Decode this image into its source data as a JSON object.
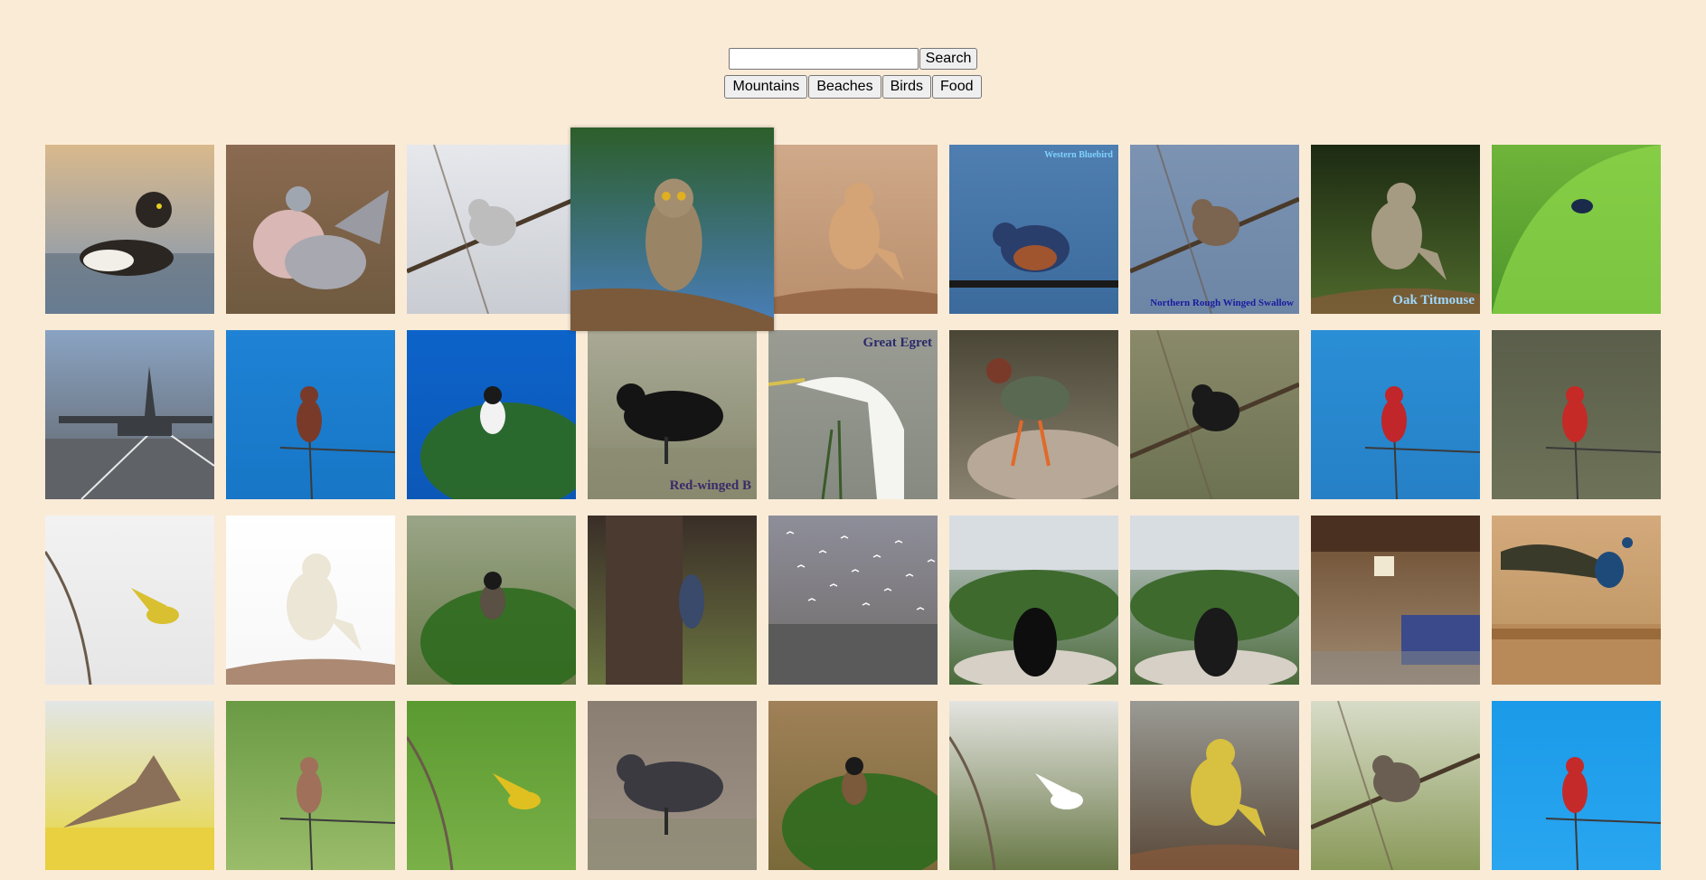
{
  "search": {
    "value": "",
    "placeholder": "",
    "button_label": "Search"
  },
  "categories": [
    {
      "label": "Mountains"
    },
    {
      "label": "Beaches"
    },
    {
      "label": "Birds"
    },
    {
      "label": "Food"
    }
  ],
  "colors": {
    "page_background": "#faebd7"
  },
  "photos": [
    {
      "name": "photo-tufted-duck",
      "bg1": "#d9b98c",
      "bg2": "#7a94b4",
      "subject": "#2b2622",
      "shape": "duck"
    },
    {
      "name": "photo-wood-pigeons",
      "bg1": "#8a6a50",
      "bg2": "#6f5a40",
      "subject": "#c9b4b6",
      "shape": "pigeon"
    },
    {
      "name": "photo-shrike-branches",
      "bg1": "#e6e8ec",
      "bg2": "#c9ccd2",
      "subject": "#bdbdbd",
      "shape": "branchbird"
    },
    {
      "name": "photo-great-horned-owl",
      "bg1": "#2d5e2a",
      "bg2": "#4a7fbf",
      "subject": "#9a8466",
      "shape": "owl",
      "zoomed": true
    },
    {
      "name": "photo-wheatear",
      "bg1": "#cfa989",
      "bg2": "#b98f6d",
      "subject": "#d4a476",
      "shape": "perched"
    },
    {
      "name": "photo-western-bluebird",
      "bg1": "#4f7eb0",
      "bg2": "#3b6a9c",
      "subject": "#2a3e6b",
      "shape": "wirebird",
      "caption": "Western Bluebird",
      "caption_color": "#7fd3ff",
      "caption_pos": "top"
    },
    {
      "name": "photo-rough-winged-swallow",
      "bg1": "#7c93b2",
      "bg2": "#6d86a6",
      "subject": "#7b6450",
      "shape": "branchbird",
      "caption": "Northern Rough Winged Swallow",
      "caption_color": "#1a1aa0",
      "caption_pos": "bottom"
    },
    {
      "name": "photo-oak-titmouse",
      "bg1": "#1c2a12",
      "bg2": "#4f6a2c",
      "subject": "#a59a82",
      "shape": "perched",
      "caption": "Oak Titmouse",
      "caption_color": "#9fd8ff",
      "caption_pos": "bottom"
    },
    {
      "name": "photo-beetle-leaf",
      "bg1": "#6fb43a",
      "bg2": "#4d962b",
      "subject": "#1a2a4a",
      "shape": "leaf"
    },
    {
      "name": "photo-cargo-plane",
      "bg1": "#8aa3c2",
      "bg2": "#5f6266",
      "subject": "#3a3d42",
      "shape": "plane"
    },
    {
      "name": "photo-vermilion-blue-sky-1",
      "bg1": "#1f82d4",
      "bg2": "#1776c6",
      "subject": "#7a3a2a",
      "shape": "stickbird"
    },
    {
      "name": "photo-chat-acacia",
      "bg1": "#0d63c9",
      "bg2": "#0c58b8",
      "subject": "#f2f2f2",
      "shape": "tree"
    },
    {
      "name": "photo-red-winged-blackbird",
      "bg1": "#a9a996",
      "bg2": "#85876a",
      "subject": "#141414",
      "shape": "ground",
      "caption": "Red-winged B",
      "caption_color": "#3a2a6a",
      "caption_pos": "bottom"
    },
    {
      "name": "photo-great-egret",
      "bg1": "#9a9c94",
      "bg2": "#868a80",
      "subject": "#f4f4f0",
      "shape": "egret",
      "caption": "Great Egret",
      "caption_color": "#2a2a6a",
      "caption_pos": "top"
    },
    {
      "name": "photo-green-heron",
      "bg1": "#4a4636",
      "bg2": "#8a8270",
      "subject": "#5a6a52",
      "shape": "heron"
    },
    {
      "name": "photo-bird-twigs",
      "bg1": "#8a8a6a",
      "bg2": "#6c7252",
      "subject": "#1a1a1a",
      "shape": "branchbird"
    },
    {
      "name": "photo-vermilion-blue-sky-2",
      "bg1": "#2a8fd6",
      "bg2": "#2680c6",
      "subject": "#c0262a",
      "shape": "stickbird"
    },
    {
      "name": "photo-vermilion-blur",
      "bg1": "#5a5e4a",
      "bg2": "#6d7258",
      "subject": "#c52a26",
      "shape": "stickbird"
    },
    {
      "name": "photo-yellow-bird-flight",
      "bg1": "#f2f2f2",
      "bg2": "#e6e6e6",
      "subject": "#d8c030",
      "shape": "flight"
    },
    {
      "name": "photo-cockatoo",
      "bg1": "#ffffff",
      "bg2": "#f7f7f7",
      "subject": "#ece6d6",
      "shape": "perched"
    },
    {
      "name": "photo-bird-pine",
      "bg1": "#9aa588",
      "bg2": "#6a7a48",
      "subject": "#5a5044",
      "shape": "tree"
    },
    {
      "name": "photo-woodpecker-trunk",
      "bg1": "#3a2e28",
      "bg2": "#6a7440",
      "subject": "#3a4a6a",
      "shape": "trunk"
    },
    {
      "name": "photo-gulls-lake",
      "bg1": "#8e8e9a",
      "bg2": "#6e6a66",
      "subject": "#ffffff",
      "shape": "sea"
    },
    {
      "name": "photo-magpie-feeder-1",
      "bg1": "#c8cfd6",
      "bg2": "#4a6a3a",
      "subject": "#0e0e0e",
      "shape": "feeder"
    },
    {
      "name": "photo-magpie-feeder-2",
      "bg1": "#c8cfd6",
      "bg2": "#4a6a3a",
      "subject": "#1a1a1a",
      "shape": "feeder"
    },
    {
      "name": "photo-bedroom",
      "bg1": "#6a4a2e",
      "bg2": "#a08a70",
      "subject": "#3a4a8a",
      "shape": "room"
    },
    {
      "name": "photo-peacock",
      "bg1": "#d4aa7c",
      "bg2": "#b8905e",
      "subject": "#1e4a7a",
      "shape": "peacock"
    },
    {
      "name": "photo-warbler-gorse",
      "bg1": "#e2e6e6",
      "bg2": "#e8d63a",
      "subject": "#8a7058",
      "shape": "singing"
    },
    {
      "name": "photo-goldfinch-1",
      "bg1": "#6a9a44",
      "bg2": "#9abc6a",
      "subject": "#a0705a",
      "shape": "stickbird"
    },
    {
      "name": "photo-goldfinch-2",
      "bg1": "#5a9a30",
      "bg2": "#7ab048",
      "subject": "#e0c020",
      "shape": "flight"
    },
    {
      "name": "photo-quail",
      "bg1": "#8a7e72",
      "bg2": "#a09488",
      "subject": "#3a3a40",
      "shape": "ground"
    },
    {
      "name": "photo-sparrow-grass",
      "bg1": "#a08058",
      "bg2": "#7a6a3a",
      "subject": "#7a5a3a",
      "shape": "tree"
    },
    {
      "name": "photo-egret-flight",
      "bg1": "#e4e4e0",
      "bg2": "#6a7a48",
      "subject": "#ffffff",
      "shape": "flight"
    },
    {
      "name": "photo-grey-wagtail",
      "bg1": "#9a9a94",
      "bg2": "#5a4a3a",
      "subject": "#d8c040",
      "shape": "perched"
    },
    {
      "name": "photo-bird-vine",
      "bg1": "#d8dcc8",
      "bg2": "#8a9a5a",
      "subject": "#6a5e52",
      "shape": "branchbird"
    },
    {
      "name": "photo-cardinal-blue-sky",
      "bg1": "#1a9ae8",
      "bg2": "#2aa6f0",
      "subject": "#c42a2a",
      "shape": "stickbird"
    }
  ]
}
